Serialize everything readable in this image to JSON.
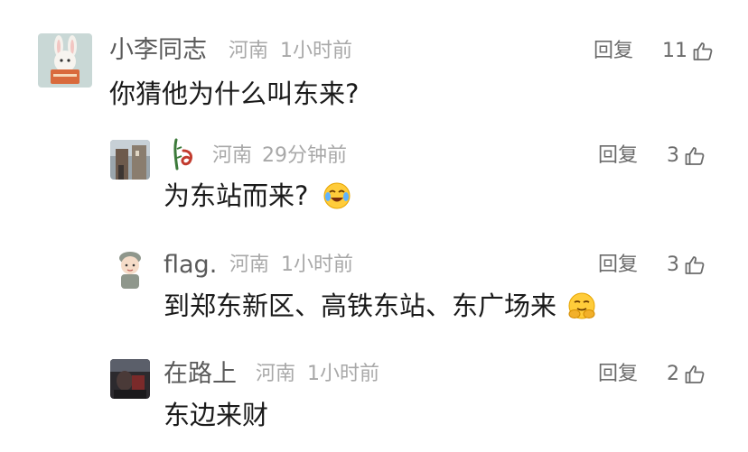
{
  "comments": [
    {
      "user": "小李同志",
      "location": "河南",
      "time": "1小时前",
      "text": "你猜他为什么叫东来?",
      "reply_label": "回复",
      "likes": "11",
      "avatar_icon": "bunny-avatar-icon"
    },
    {
      "user": "",
      "location": "河南",
      "time": "29分钟前",
      "text": "为东站而来?",
      "reply_label": "回复",
      "likes": "3",
      "avatar_icon": "street-photo-avatar-icon",
      "name_icon": "bamboo-logo-icon",
      "emoji": "crying-laughing-emoji-icon"
    },
    {
      "user": "flag.",
      "location": "河南",
      "time": "1小时前",
      "text": "到郑东新区、高铁东站、东广场来",
      "reply_label": "回复",
      "likes": "3",
      "avatar_icon": "cartoon-soldier-avatar-icon",
      "emoji": "hugging-face-emoji-icon"
    },
    {
      "user": "在路上",
      "location": "河南",
      "time": "1小时前",
      "text": "东边来财",
      "reply_label": "回复",
      "likes": "2",
      "avatar_icon": "dark-photo-avatar-icon"
    }
  ],
  "colors": {
    "name": "#5a5a5a",
    "meta": "#a8a8a8",
    "content": "#1a1a1a",
    "action": "#6b6b6b"
  }
}
